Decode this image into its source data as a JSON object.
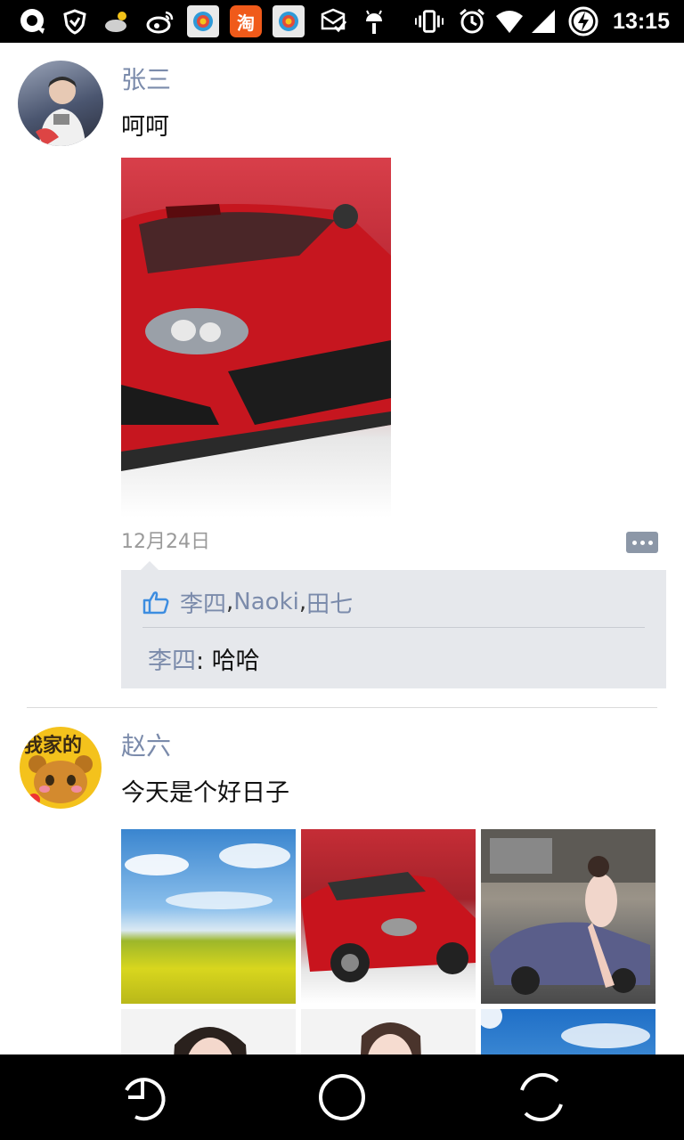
{
  "status_bar": {
    "time": "13:15",
    "left_icons": [
      "cloud-sync-icon",
      "shield-vpn-icon",
      "weather-icon",
      "weibo-icon",
      "app-launcher-icon",
      "taobao-icon",
      "app-launcher-icon",
      "email-icon",
      "android-debug-icon"
    ],
    "right_icons": [
      "vibrate-icon",
      "alarm-icon",
      "wifi-icon",
      "cell-signal-icon",
      "battery-charging-icon"
    ],
    "taobao_label": "淘"
  },
  "posts": [
    {
      "author": "张三",
      "text": "呵呵",
      "timestamp": "12月24日",
      "likes": [
        "李四",
        "Naoki",
        "田七"
      ],
      "like_separator": ",",
      "comments": [
        {
          "author": "李四",
          "separator": ": ",
          "text": "哈哈"
        }
      ],
      "images": [
        "red-sports-car"
      ]
    },
    {
      "author": "赵六",
      "text": "今天是个好日子",
      "avatar_label": "我家的",
      "images": [
        "sky-flower-field",
        "red-sports-car",
        "model-with-car",
        "portrait-woman",
        "portrait-woman-smiling",
        "blue-sky"
      ]
    }
  ],
  "colors": {
    "name_blue": "#7b8bab",
    "comment_box": "#e6e8ec",
    "status_bar": "#000000"
  },
  "nav_bar": {
    "buttons": [
      "back-button",
      "home-button",
      "recents-button"
    ]
  }
}
